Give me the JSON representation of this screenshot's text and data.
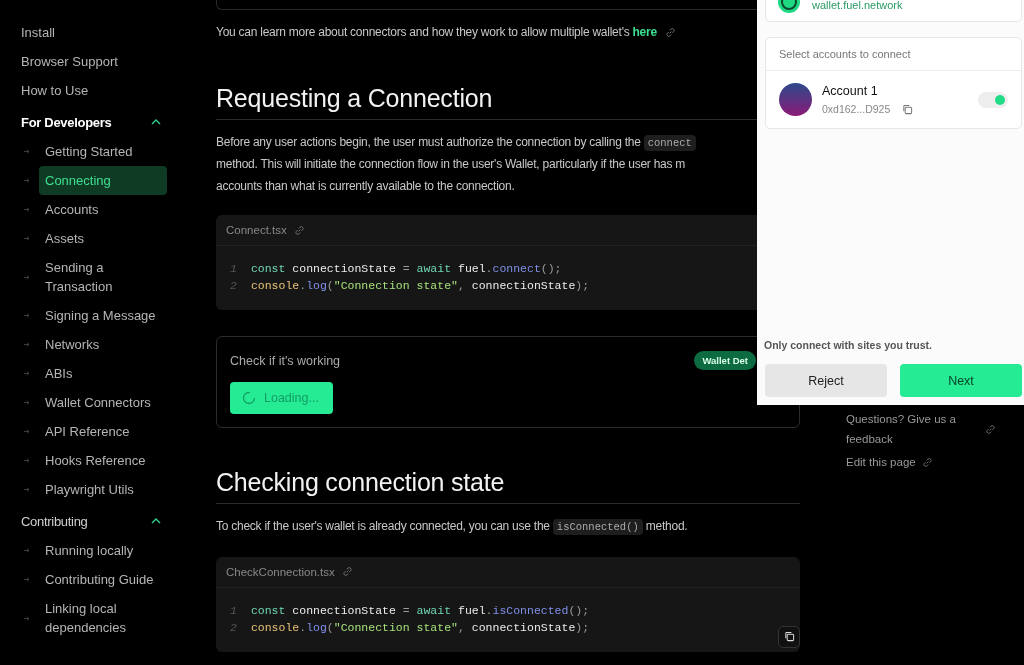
{
  "sidebar": {
    "items": [
      {
        "label": "Install",
        "kind": "link",
        "selected": false
      },
      {
        "label": "Browser Support",
        "kind": "link",
        "selected": false
      },
      {
        "label": "How to Use",
        "kind": "link",
        "selected": false
      },
      {
        "label": "For Developers",
        "kind": "section",
        "active": true,
        "expanded": true,
        "children": [
          {
            "label": "Getting Started",
            "selected": false
          },
          {
            "label": "Connecting",
            "selected": true
          },
          {
            "label": "Accounts",
            "selected": false
          },
          {
            "label": "Assets",
            "selected": false
          },
          {
            "label": "Sending a Transaction",
            "selected": false
          },
          {
            "label": "Signing a Message",
            "selected": false
          },
          {
            "label": "Networks",
            "selected": false
          },
          {
            "label": "ABIs",
            "selected": false
          },
          {
            "label": "Wallet Connectors",
            "selected": false
          },
          {
            "label": "API Reference",
            "selected": false
          },
          {
            "label": "Hooks Reference",
            "selected": false
          },
          {
            "label": "Playwright Utils",
            "selected": false
          }
        ]
      },
      {
        "label": "Contributing",
        "kind": "section",
        "active": false,
        "expanded": true,
        "children": [
          {
            "label": "Running locally",
            "selected": false
          },
          {
            "label": "Contributing Guide",
            "selected": false
          },
          {
            "label": "Linking local dependencies",
            "selected": false
          }
        ]
      }
    ]
  },
  "content": [
    {
      "kind": "paragraph",
      "lines": [
        [
          {
            "text": "You can learn more about connectors and how they work to allow multiple wallet's ",
            "kind": "text"
          },
          {
            "text": "here",
            "kind": "link"
          }
        ]
      ]
    },
    {
      "kind": "heading",
      "text": "Requesting a Connection"
    },
    {
      "kind": "paragraph",
      "lines": [
        [
          {
            "text": "Before any user actions begin, the user must authorize the connection by calling the ",
            "kind": "text"
          },
          {
            "text": "connect",
            "kind": "code"
          }
        ],
        [
          {
            "text": "method. This will initiate the connection flow in the user's Wallet, particularly if the user has m",
            "kind": "text"
          }
        ],
        [
          {
            "text": "accounts than what is currently available to the connection.",
            "kind": "text"
          }
        ]
      ]
    },
    {
      "kind": "code",
      "file": "Connect.tsx",
      "lines": [
        {
          "number": "1",
          "tokens": [
            {
              "text": "const",
              "kind": "keyword"
            },
            {
              "text": " connectionState ",
              "kind": "name"
            },
            {
              "text": "=",
              "kind": "operator"
            },
            {
              "text": " await",
              "kind": "keyword"
            },
            {
              "text": " fuel",
              "kind": "name"
            },
            {
              "text": ".",
              "kind": "operator"
            },
            {
              "text": "connect",
              "kind": "function"
            },
            {
              "text": "();",
              "kind": "operator"
            }
          ]
        },
        {
          "number": "2",
          "tokens": [
            {
              "text": "console",
              "kind": "object"
            },
            {
              "text": ".",
              "kind": "operator"
            },
            {
              "text": "log",
              "kind": "function"
            },
            {
              "text": "(",
              "kind": "operator"
            },
            {
              "text": "\"Connection state\"",
              "kind": "string"
            },
            {
              "text": ", ",
              "kind": "operator"
            },
            {
              "text": "connectionState",
              "kind": "name"
            },
            {
              "text": ");",
              "kind": "operator"
            }
          ]
        }
      ]
    },
    {
      "kind": "demo",
      "title": "Check if it's working",
      "badge": "Wallet Det",
      "button": "Loading..."
    },
    {
      "kind": "heading",
      "text": "Checking connection state"
    },
    {
      "kind": "paragraph",
      "lines": [
        [
          {
            "text": "To check if the user's wallet is already connected, you can use the ",
            "kind": "text"
          },
          {
            "text": "isConnected()",
            "kind": "code"
          },
          {
            "text": " method.",
            "kind": "text"
          }
        ]
      ]
    },
    {
      "kind": "code",
      "file": "CheckConnection.tsx",
      "copy": true,
      "lines": [
        {
          "number": "1",
          "tokens": [
            {
              "text": "const",
              "kind": "keyword"
            },
            {
              "text": " connectionState ",
              "kind": "name"
            },
            {
              "text": "=",
              "kind": "operator"
            },
            {
              "text": " await",
              "kind": "keyword"
            },
            {
              "text": " fuel",
              "kind": "name"
            },
            {
              "text": ".",
              "kind": "operator"
            },
            {
              "text": "isConnected",
              "kind": "function"
            },
            {
              "text": "();",
              "kind": "operator"
            }
          ]
        },
        {
          "number": "2",
          "tokens": [
            {
              "text": "console",
              "kind": "object"
            },
            {
              "text": ".",
              "kind": "operator"
            },
            {
              "text": "log",
              "kind": "function"
            },
            {
              "text": "(",
              "kind": "operator"
            },
            {
              "text": "\"Connection state\"",
              "kind": "string"
            },
            {
              "text": ", ",
              "kind": "operator"
            },
            {
              "text": "connectionState",
              "kind": "name"
            },
            {
              "text": ");",
              "kind": "operator"
            }
          ]
        }
      ]
    }
  ],
  "aside": {
    "links": [
      "Questions? Give us a feedback",
      "Edit this page"
    ]
  },
  "wallet": {
    "site": "wallet.fuel.network",
    "accounts_title": "Select accounts to connect",
    "accounts": [
      {
        "name": "Account 1",
        "address": "0xd162...D925",
        "on": true
      }
    ],
    "notice": "Only connect with sites you trust.",
    "buttons": [
      {
        "label": "Reject",
        "kind": "secondary"
      },
      {
        "label": "Next",
        "kind": "primary"
      }
    ]
  }
}
